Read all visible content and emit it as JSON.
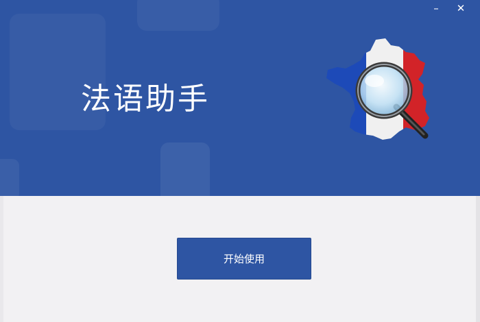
{
  "window": {
    "minimize_glyph": "–",
    "close_glyph": "✕"
  },
  "banner": {
    "title": "法语助手",
    "logo_icon": "france-map-magnifier-icon",
    "background_color": "#2e55a3"
  },
  "main": {
    "start_button_label": "开始使用",
    "background_color": "#f2f1f3"
  },
  "colors": {
    "accent": "#2e55a3",
    "flag_blue": "#1f4fc4",
    "flag_white": "#ffffff",
    "flag_red": "#e0262b"
  }
}
